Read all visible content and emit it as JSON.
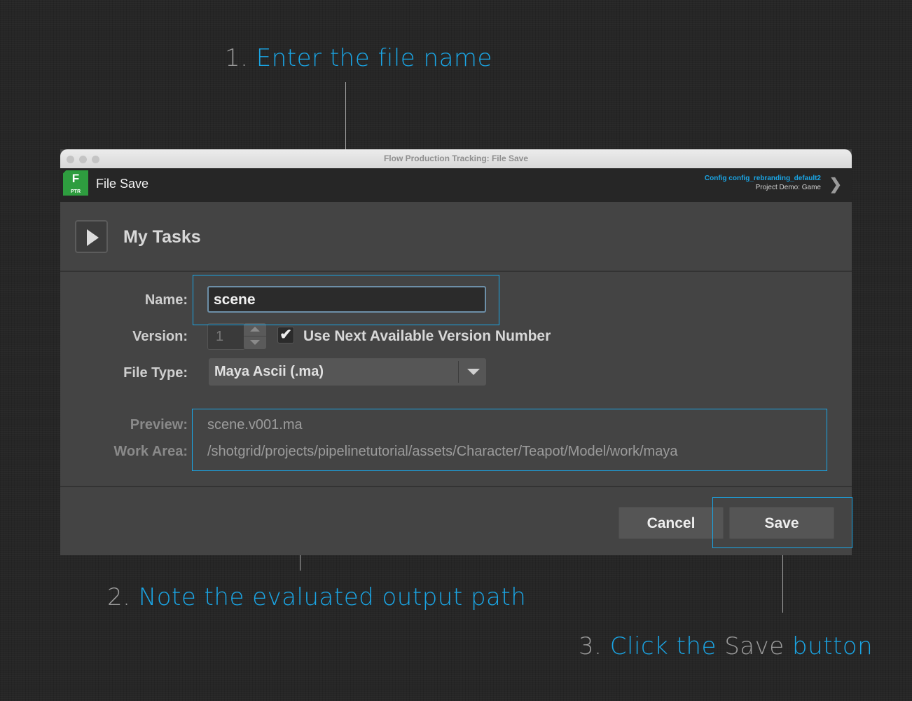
{
  "callouts": {
    "one": {
      "num": "1.",
      "text": "Enter the file name"
    },
    "two": {
      "num": "2.",
      "text": "Note the evaluated output path"
    },
    "three": {
      "num": "3.",
      "text_a": "Click the",
      "text_b": "Save",
      "text_c": "button"
    }
  },
  "window": {
    "title": "Flow Production Tracking: File Save",
    "app_title": "File Save",
    "logo_letter": "F",
    "logo_sub": "PTR",
    "config": "Config config_rebranding_default2",
    "project": "Project Demo: Game"
  },
  "tasks": {
    "label": "My Tasks"
  },
  "form": {
    "name_label": "Name:",
    "name_value": "scene",
    "version_label": "Version:",
    "version_value": "1",
    "use_next_checked": true,
    "use_next_label": "Use Next Available Version Number",
    "file_type_label": "File Type:",
    "file_type_value": "Maya Ascii (.ma)",
    "preview_label": "Preview:",
    "preview_value": "scene.v001.ma",
    "work_area_label": "Work Area:",
    "work_area_value": "/shotgrid/projects/pipelinetutorial/assets/Character/Teapot/Model/work/maya"
  },
  "buttons": {
    "cancel": "Cancel",
    "save": "Save"
  },
  "colors": {
    "accent": "#1aa6e6",
    "logo": "#2e9d3f"
  }
}
